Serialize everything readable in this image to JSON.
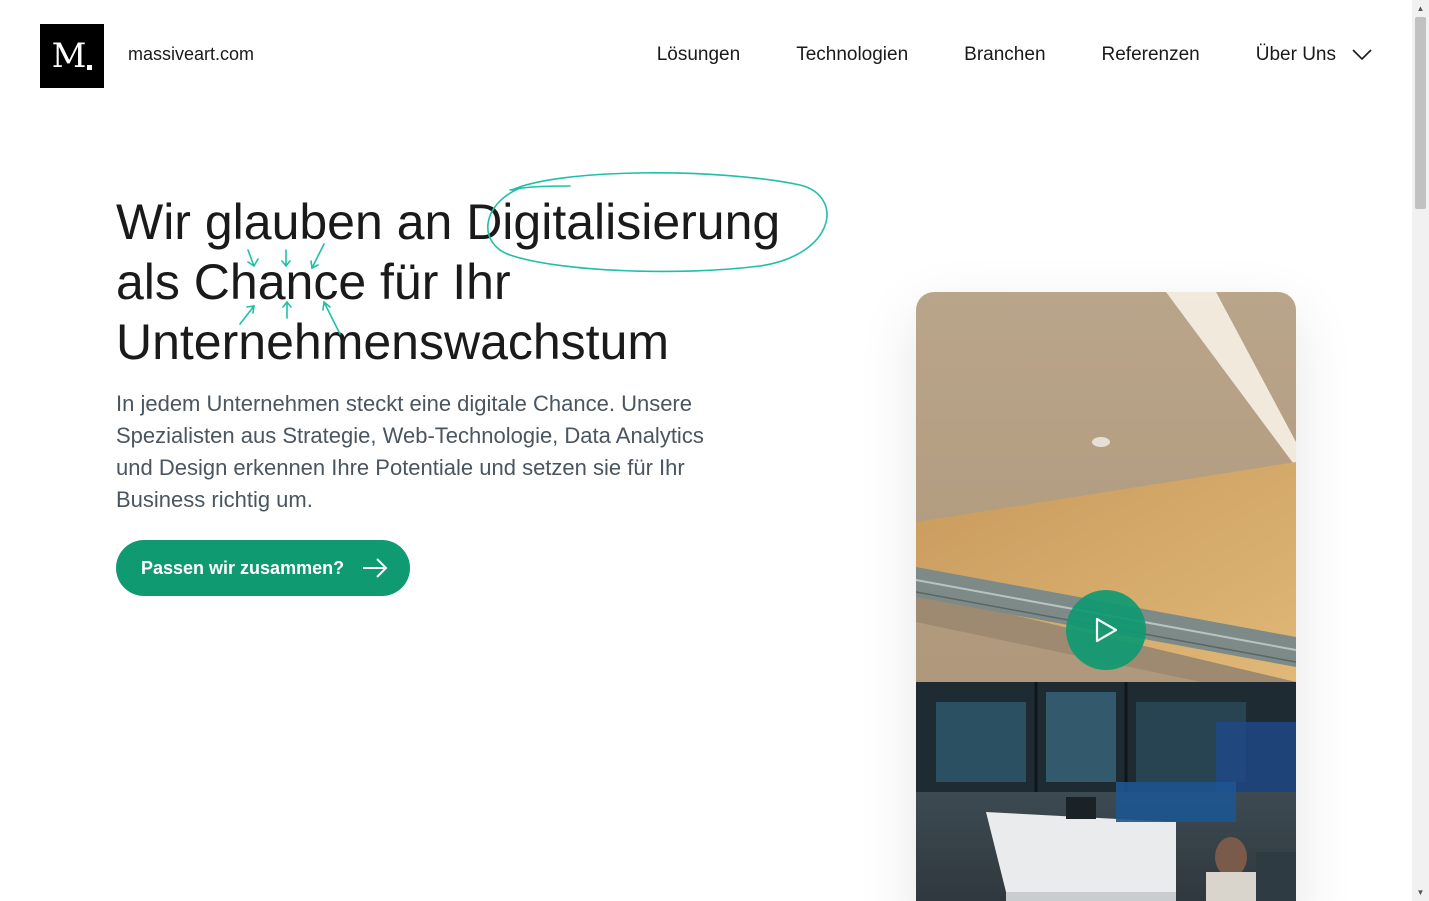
{
  "brand": {
    "logo_letter": "M",
    "site_name": "massiveart.com"
  },
  "nav": {
    "items": [
      {
        "label": "Lösungen"
      },
      {
        "label": "Technologien"
      },
      {
        "label": "Branchen"
      },
      {
        "label": "Referenzen"
      },
      {
        "label": "Über Uns"
      }
    ]
  },
  "hero": {
    "headline_lines": [
      "Wir glauben an Digitalisierung",
      "als Chance für Ihr",
      "Unternehmenswachstum"
    ],
    "lead": "In jedem Unternehmen steckt eine digitale Chance. Unsere Spezialisten aus Strategie, Web-Technologie, Data Analytics und Design erkennen Ihre Potentiale und setzen sie für Ihr Business richtig um.",
    "cta_label": "Passen wir zusammen?"
  },
  "colors": {
    "accent": "#0f9a72",
    "scribble": "#1fbfa8",
    "text": "#1a1a1a",
    "lead_text": "#4a5560"
  }
}
